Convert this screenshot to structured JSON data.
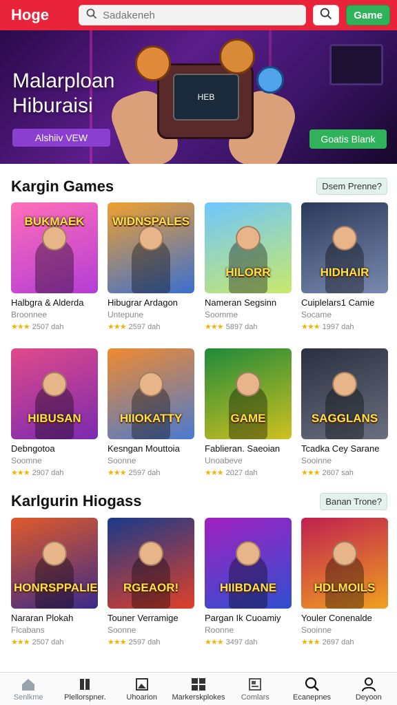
{
  "topbar": {
    "logo": "Hoge",
    "search_placeholder": "Sadakeneh",
    "game_button": "Game",
    "colors": {
      "brand": "#e8233a",
      "accent": "#2fb25a"
    }
  },
  "hero": {
    "title_line1": "Malarploan",
    "title_line2": "Hiburaisi",
    "screen_text": "HEB",
    "button_left": "Alshiiv VEW",
    "button_right": "Goatis Blank"
  },
  "section1": {
    "title": "Kargin Games",
    "pill": "Dsem Prenne?",
    "cards": [
      {
        "thumb_text": "BUKMAEK",
        "title": "Halbgra & Alderda",
        "subtitle": "Broonnee",
        "rating": "2507 dah",
        "stars": 3
      },
      {
        "thumb_text": "WIDNSPALES",
        "title": "Hibugrar Ardagon",
        "subtitle": "Untepune",
        "rating": "2597 dah",
        "stars": 3
      },
      {
        "thumb_text": "HILORR",
        "title": "Nameran Segsinn",
        "subtitle": "Soomme",
        "rating": "5897 dah",
        "stars": 3
      },
      {
        "thumb_text": "HIDHAIR",
        "title": "Cuiplelars1 Camie",
        "subtitle": "Socame",
        "rating": "1997 dah",
        "stars": 3
      },
      {
        "thumb_text": "HIBUSAN",
        "title": "Debngotoa",
        "subtitle": "Soomne",
        "rating": "2907 dah",
        "stars": 3
      },
      {
        "thumb_text": "HIIOKATTY",
        "title": "Kesngan Mouttoia",
        "subtitle": "Soonne",
        "rating": "2597 dah",
        "stars": 3
      },
      {
        "thumb_text": "GAME",
        "title": "Fablieran. Saeoian",
        "subtitle": "Unoabeve",
        "rating": "2027 dah",
        "stars": 3
      },
      {
        "thumb_text": "SAGGLANS",
        "title": "Tcadka Cey Sarane",
        "subtitle": "Sooinne",
        "rating": "2607 sah",
        "stars": 3
      }
    ]
  },
  "section2": {
    "title": "Karlgurin Hiogass",
    "pill": "Banan Trone?",
    "cards": [
      {
        "thumb_text": "HONRSPPALIES",
        "title": "Nararan Plokah",
        "subtitle": "Flcabans",
        "rating": "2507 dah",
        "stars": 3
      },
      {
        "thumb_text": "RGEAOR!",
        "title": "Touner Verramige",
        "subtitle": "Soonne",
        "rating": "2597 dah",
        "stars": 3
      },
      {
        "thumb_text": "HIIBDANE",
        "title": "Pargan Ik Cuoamiy",
        "subtitle": "Roonne",
        "rating": "3497 dah",
        "stars": 3
      },
      {
        "thumb_text": "HDLMOILS",
        "title": "Youler Conenalde",
        "subtitle": "Sooinne",
        "rating": "2697 dah",
        "stars": 3
      }
    ]
  },
  "bottomnav": [
    {
      "label": "Senlkme",
      "icon": "home-icon"
    },
    {
      "label": "Plellorspner.",
      "icon": "book-icon"
    },
    {
      "label": "Uhoarion",
      "icon": "image-icon"
    },
    {
      "label": "Markerskplokes",
      "icon": "grid-icon"
    },
    {
      "label": "Comlars",
      "icon": "news-icon"
    },
    {
      "label": "Ecanepnes",
      "icon": "search-icon"
    },
    {
      "label": "Deyoon",
      "icon": "user-icon"
    }
  ]
}
